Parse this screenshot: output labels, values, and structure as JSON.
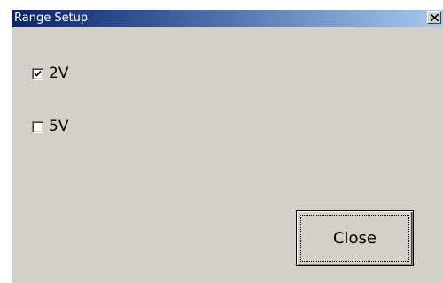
{
  "window": {
    "title": "Range Setup"
  },
  "options": [
    {
      "label": "2V",
      "checked": true
    },
    {
      "label": "5V",
      "checked": false
    }
  ],
  "buttons": {
    "close_label": "Close"
  },
  "colors": {
    "title_gradient_start": "#0a246a",
    "title_gradient_end": "#a6caf0",
    "dialog_face": "#d4d0c8"
  },
  "icons": {
    "title_close": "close-icon",
    "checkmark": "checkmark-icon"
  }
}
